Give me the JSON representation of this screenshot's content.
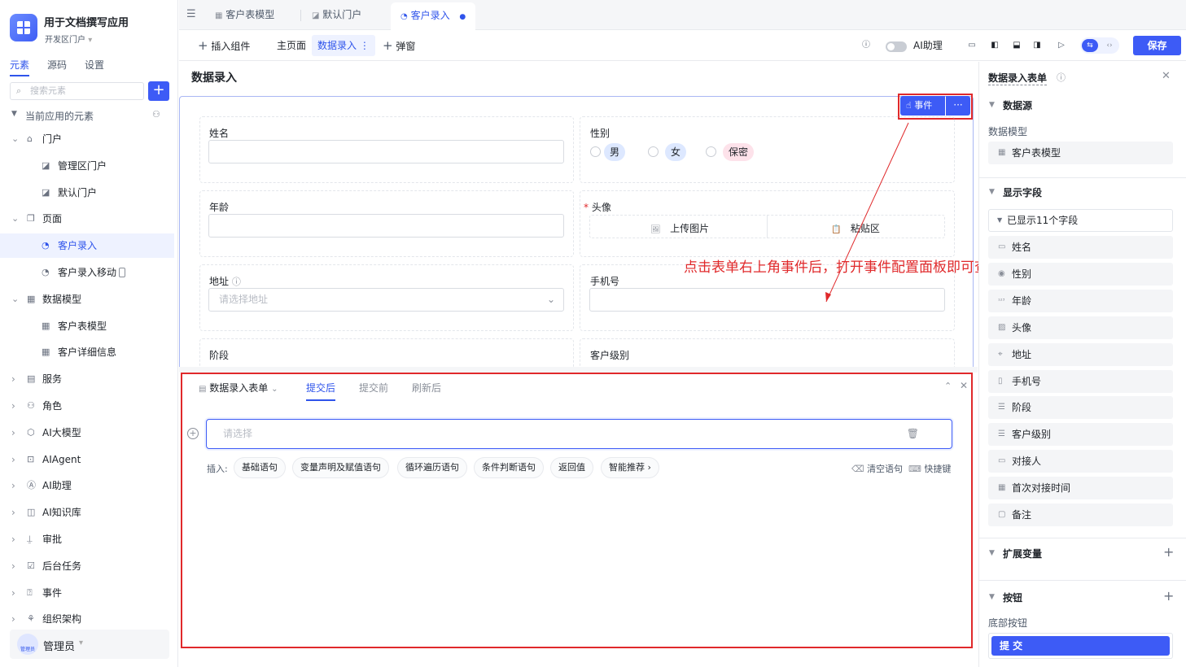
{
  "app": {
    "title": "用于文档撰写应用",
    "portal": "开发区门户"
  },
  "left_tabs": [
    "元素",
    "源码",
    "设置"
  ],
  "search_placeholder": "搜索元素",
  "tree_header": "当前应用的元素",
  "tree": [
    {
      "label": "门户",
      "level": 0,
      "expanded": true,
      "icon": "home-icon"
    },
    {
      "label": "管理区门户",
      "level": 1,
      "icon": "portal-icon"
    },
    {
      "label": "默认门户",
      "level": 1,
      "icon": "portal-icon"
    },
    {
      "label": "页面",
      "level": 0,
      "expanded": true,
      "icon": "page-icon"
    },
    {
      "label": "客户录入",
      "level": 1,
      "icon": "form-page-icon",
      "selected": true
    },
    {
      "label": "客户录入移动",
      "level": 1,
      "icon": "form-page-icon"
    },
    {
      "label": "数据模型",
      "level": 0,
      "expanded": true,
      "icon": "table-icon"
    },
    {
      "label": "客户表模型",
      "level": 1,
      "icon": "table-icon"
    },
    {
      "label": "客户详细信息",
      "level": 1,
      "icon": "table-icon"
    },
    {
      "label": "服务",
      "level": 0,
      "icon": "service-icon"
    },
    {
      "label": "角色",
      "level": 0,
      "icon": "role-icon"
    },
    {
      "label": "AI大模型",
      "level": 0,
      "icon": "ai-model-icon"
    },
    {
      "label": "AIAgent",
      "level": 0,
      "icon": "agent-icon"
    },
    {
      "label": "AI助理",
      "level": 0,
      "icon": "ai-assistant-icon"
    },
    {
      "label": "AI知识库",
      "level": 0,
      "icon": "knowledge-icon"
    },
    {
      "label": "审批",
      "level": 0,
      "icon": "approval-icon"
    },
    {
      "label": "后台任务",
      "level": 0,
      "icon": "task-icon"
    },
    {
      "label": "事件",
      "level": 0,
      "icon": "event-icon"
    },
    {
      "label": "组织架构",
      "level": 0,
      "icon": "org-icon"
    }
  ],
  "user": {
    "name": "管理员",
    "avatar_text": "管理员"
  },
  "tabs": [
    {
      "label": "客户表模型"
    },
    {
      "label": "默认门户"
    },
    {
      "label": "客户录入",
      "active": true
    }
  ],
  "toolbar": {
    "insert": "插入组件",
    "home": "主页面",
    "data_entry": "数据录入",
    "popup": "弹窗",
    "ai_assistant": "AI助理",
    "save": "保存"
  },
  "page_title": "数据录入",
  "event_btn": "事件",
  "form": {
    "name_label": "姓名",
    "gender_label": "性别",
    "gender_options": [
      "男",
      "女",
      "保密"
    ],
    "age_label": "年龄",
    "avatar_label": "头像",
    "upload_label": "上传图片",
    "paste_label": "粘贴区",
    "address_label": "地址",
    "address_placeholder": "请选择地址",
    "phone_label": "手机号",
    "stage_label": "阶段",
    "level_label": "客户级别"
  },
  "annotation": "点击表单右上角事件后，打开事件配置面板即可查看",
  "bottom": {
    "form_name": "数据录入表单",
    "tabs": [
      "提交后",
      "提交前",
      "刷新后"
    ],
    "select_placeholder": "请选择",
    "insert_label": "插入:",
    "chips": [
      "基础语句",
      "变量声明及赋值语句",
      "循环遍历语句",
      "条件判断语句",
      "返回值",
      "智能推荐"
    ],
    "clear": "清空语句",
    "shortcut": "快捷键"
  },
  "right": {
    "title": "数据录入表单",
    "datasource": "数据源",
    "data_model_label": "数据模型",
    "data_model": "客户表模型",
    "display_fields": "显示字段",
    "shown_count": "已显示11个字段",
    "fields": [
      {
        "label": "姓名",
        "icon": "text-icon"
      },
      {
        "label": "性别",
        "icon": "radio-icon"
      },
      {
        "label": "年龄",
        "icon": "number-icon"
      },
      {
        "label": "头像",
        "icon": "image-icon"
      },
      {
        "label": "地址",
        "icon": "location-icon"
      },
      {
        "label": "手机号",
        "icon": "phone-icon"
      },
      {
        "label": "阶段",
        "icon": "select-icon"
      },
      {
        "label": "客户级别",
        "icon": "select-icon"
      },
      {
        "label": "对接人",
        "icon": "text-icon"
      },
      {
        "label": "首次对接时间",
        "icon": "date-icon"
      },
      {
        "label": "备注",
        "icon": "textarea-icon"
      }
    ],
    "ext_vars": "扩展变量",
    "buttons": "按钮",
    "bottom_buttons": "底部按钮",
    "submit": "提 交"
  },
  "colors": {
    "primary": "#3d5bf6",
    "highlight": "#e0292b",
    "annotation": "#e0292b"
  }
}
